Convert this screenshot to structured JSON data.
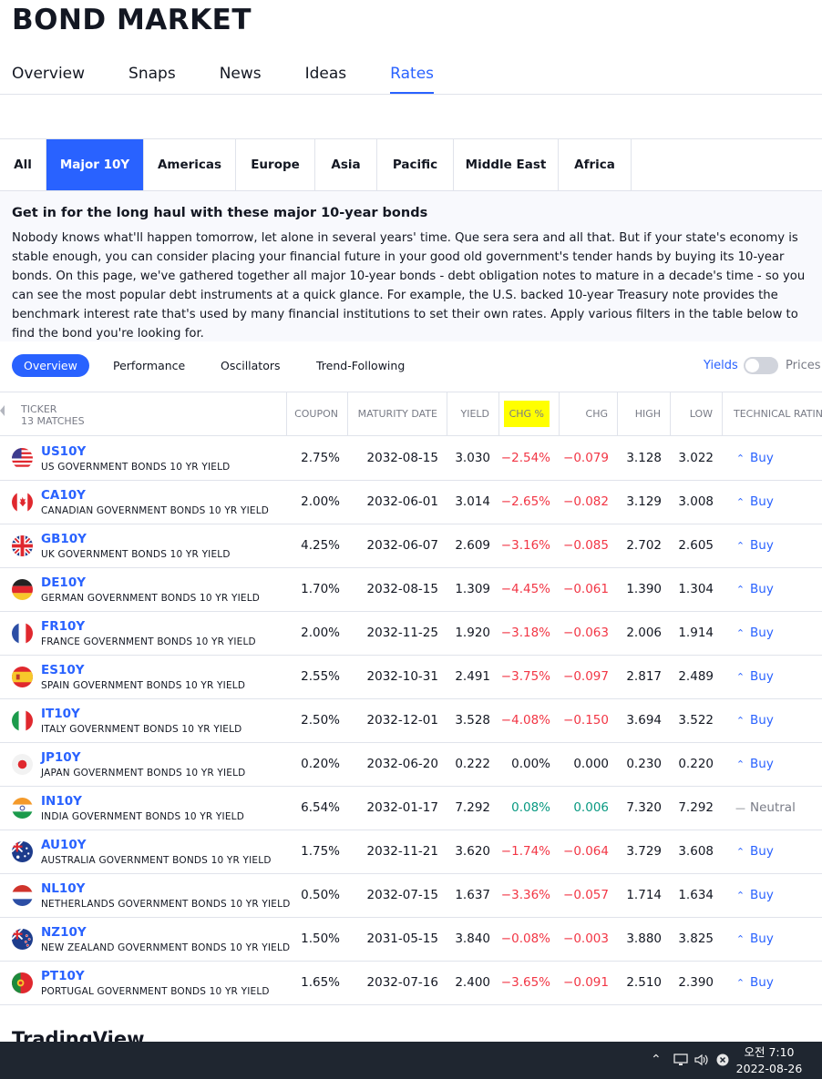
{
  "page_title": "BOND MARKET",
  "main_tabs": [
    {
      "label": "Overview",
      "active": false
    },
    {
      "label": "Snaps",
      "active": false
    },
    {
      "label": "News",
      "active": false
    },
    {
      "label": "Ideas",
      "active": false
    },
    {
      "label": "Rates",
      "active": true
    }
  ],
  "region_tabs": [
    {
      "label": "All",
      "active": false
    },
    {
      "label": "Major 10Y",
      "active": true
    },
    {
      "label": "Americas",
      "active": false
    },
    {
      "label": "Europe",
      "active": false
    },
    {
      "label": "Asia",
      "active": false
    },
    {
      "label": "Pacific",
      "active": false
    },
    {
      "label": "Middle East",
      "active": false
    },
    {
      "label": "Africa",
      "active": false
    }
  ],
  "intro": {
    "heading": "Get in for the long haul with these major 10-year bonds",
    "body": "Nobody knows what'll happen tomorrow, let alone in several years' time. Que sera sera and all that. But if your state's economy is stable enough, you can consider placing your financial future in your good old government's tender hands by buying its 10-year bonds. On this page, we've gathered together all major 10-year bonds - debt obligation notes to mature in a decade's time - so you can see the most popular debt instruments at a quick glance. For example, the U.S. backed 10-year Treasury note provides the benchmark interest rate that's used by many financial institutions to set their own rates. Apply various filters in the table below to find the bond you're looking for."
  },
  "filters": {
    "overview": "Overview",
    "performance": "Performance",
    "oscillators": "Oscillators",
    "trend": "Trend-Following",
    "yields": "Yields",
    "prices": "Prices"
  },
  "table": {
    "ticker_header": "TICKER",
    "matches": "13 MATCHES",
    "columns": [
      "COUPON",
      "MATURITY DATE",
      "YIELD",
      "CHG %",
      "CHG",
      "HIGH",
      "LOW",
      "TECHNICAL RATING"
    ],
    "rows": [
      {
        "symbol": "US10Y",
        "name": "US GOVERNMENT BONDS 10 YR YIELD",
        "coupon": "2.75%",
        "maturity": "2032-08-15",
        "yield": "3.030",
        "chg_pct": "−2.54%",
        "chg": "−0.079",
        "high": "3.128",
        "low": "3.022",
        "rating": "Buy",
        "dir": "neg",
        "flag": "us"
      },
      {
        "symbol": "CA10Y",
        "name": "CANADIAN GOVERNMENT BONDS 10 YR YIELD",
        "coupon": "2.00%",
        "maturity": "2032-06-01",
        "yield": "3.014",
        "chg_pct": "−2.65%",
        "chg": "−0.082",
        "high": "3.129",
        "low": "3.008",
        "rating": "Buy",
        "dir": "neg",
        "flag": "ca"
      },
      {
        "symbol": "GB10Y",
        "name": "UK GOVERNMENT BONDS 10 YR YIELD",
        "coupon": "4.25%",
        "maturity": "2032-06-07",
        "yield": "2.609",
        "chg_pct": "−3.16%",
        "chg": "−0.085",
        "high": "2.702",
        "low": "2.605",
        "rating": "Buy",
        "dir": "neg",
        "flag": "gb"
      },
      {
        "symbol": "DE10Y",
        "name": "GERMAN GOVERNMENT BONDS 10 YR YIELD",
        "coupon": "1.70%",
        "maturity": "2032-08-15",
        "yield": "1.309",
        "chg_pct": "−4.45%",
        "chg": "−0.061",
        "high": "1.390",
        "low": "1.304",
        "rating": "Buy",
        "dir": "neg",
        "flag": "de"
      },
      {
        "symbol": "FR10Y",
        "name": "FRANCE GOVERNMENT BONDS 10 YR YIELD",
        "coupon": "2.00%",
        "maturity": "2032-11-25",
        "yield": "1.920",
        "chg_pct": "−3.18%",
        "chg": "−0.063",
        "high": "2.006",
        "low": "1.914",
        "rating": "Buy",
        "dir": "neg",
        "flag": "fr"
      },
      {
        "symbol": "ES10Y",
        "name": "SPAIN GOVERNMENT BONDS 10 YR YIELD",
        "coupon": "2.55%",
        "maturity": "2032-10-31",
        "yield": "2.491",
        "chg_pct": "−3.75%",
        "chg": "−0.097",
        "high": "2.817",
        "low": "2.489",
        "rating": "Buy",
        "dir": "neg",
        "flag": "es"
      },
      {
        "symbol": "IT10Y",
        "name": "ITALY GOVERNMENT BONDS 10 YR YIELD",
        "coupon": "2.50%",
        "maturity": "2032-12-01",
        "yield": "3.528",
        "chg_pct": "−4.08%",
        "chg": "−0.150",
        "high": "3.694",
        "low": "3.522",
        "rating": "Buy",
        "dir": "neg",
        "flag": "it"
      },
      {
        "symbol": "JP10Y",
        "name": "JAPAN GOVERNMENT BONDS 10 YR YIELD",
        "coupon": "0.20%",
        "maturity": "2032-06-20",
        "yield": "0.222",
        "chg_pct": "0.00%",
        "chg": "0.000",
        "high": "0.230",
        "low": "0.220",
        "rating": "Buy",
        "dir": "flat",
        "flag": "jp"
      },
      {
        "symbol": "IN10Y",
        "name": "INDIA GOVERNMENT BONDS 10 YR YIELD",
        "coupon": "6.54%",
        "maturity": "2032-01-17",
        "yield": "7.292",
        "chg_pct": "0.08%",
        "chg": "0.006",
        "high": "7.320",
        "low": "7.292",
        "rating": "Neutral",
        "dir": "pos",
        "flag": "in"
      },
      {
        "symbol": "AU10Y",
        "name": "AUSTRALIA GOVERNMENT BONDS 10 YR YIELD",
        "coupon": "1.75%",
        "maturity": "2032-11-21",
        "yield": "3.620",
        "chg_pct": "−1.74%",
        "chg": "−0.064",
        "high": "3.729",
        "low": "3.608",
        "rating": "Buy",
        "dir": "neg",
        "flag": "au"
      },
      {
        "symbol": "NL10Y",
        "name": "NETHERLANDS GOVERNMENT BONDS 10 YR YIELD",
        "coupon": "0.50%",
        "maturity": "2032-07-15",
        "yield": "1.637",
        "chg_pct": "−3.36%",
        "chg": "−0.057",
        "high": "1.714",
        "low": "1.634",
        "rating": "Buy",
        "dir": "neg",
        "flag": "nl"
      },
      {
        "symbol": "NZ10Y",
        "name": "NEW ZEALAND GOVERNMENT BONDS 10 YR YIELD",
        "coupon": "1.50%",
        "maturity": "2031-05-15",
        "yield": "3.840",
        "chg_pct": "−0.08%",
        "chg": "−0.003",
        "high": "3.880",
        "low": "3.825",
        "rating": "Buy",
        "dir": "neg",
        "flag": "nz"
      },
      {
        "symbol": "PT10Y",
        "name": "PORTUGAL GOVERNMENT BONDS 10 YR YIELD",
        "coupon": "1.65%",
        "maturity": "2032-07-16",
        "yield": "2.400",
        "chg_pct": "−3.65%",
        "chg": "−0.091",
        "high": "2.510",
        "low": "2.390",
        "rating": "Buy",
        "dir": "neg",
        "flag": "pt"
      }
    ]
  },
  "footer_logo": "TradingView",
  "taskbar": {
    "time": "오전 7:10",
    "date": "2022-08-26",
    "icons": [
      "chevron-up-icon",
      "network-icon",
      "volume-icon",
      "close-circle-icon"
    ]
  },
  "colors": {
    "accent": "#2962ff",
    "negative": "#f23645",
    "positive": "#089981",
    "highlight": "#ffff00"
  }
}
